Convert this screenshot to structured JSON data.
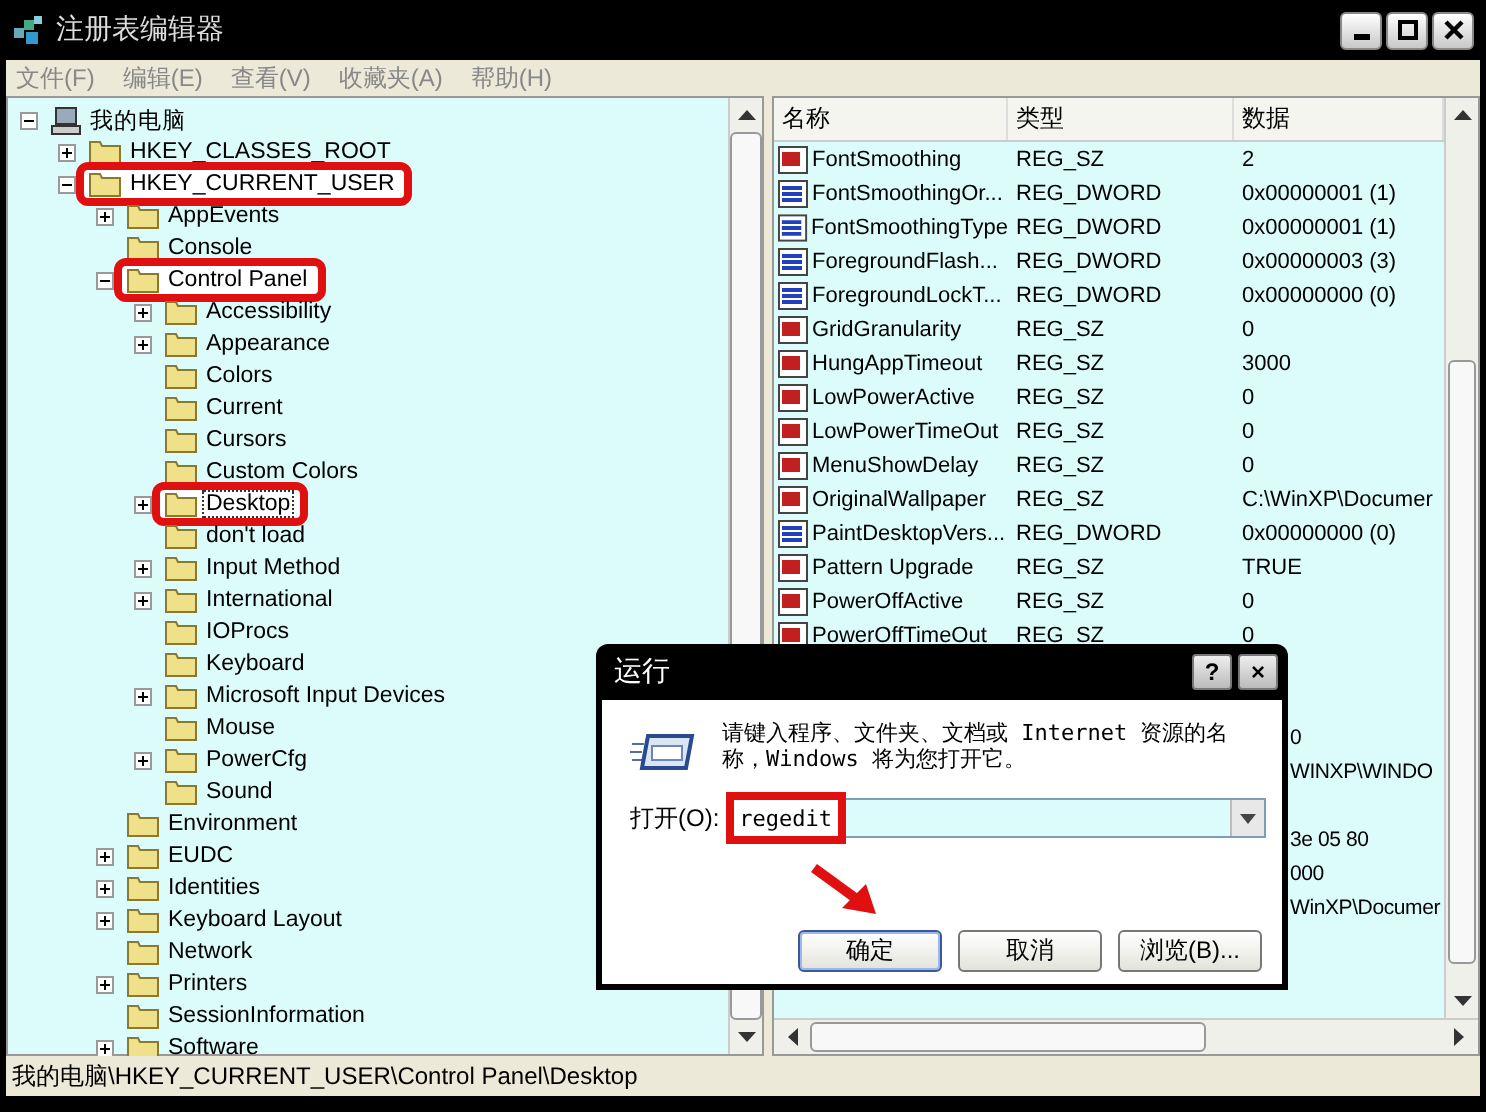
{
  "window": {
    "title": "注册表编辑器"
  },
  "menu": [
    "文件(F)",
    "编辑(E)",
    "查看(V)",
    "收藏夹(A)",
    "帮助(H)"
  ],
  "tree": {
    "label": "我的电脑",
    "kind": "open",
    "selected": false,
    "marked": false,
    "children": [
      {
        "label": "HKEY_CLASSES_ROOT",
        "kind": "closed",
        "selected": false,
        "marked": false
      },
      {
        "label": "HKEY_CURRENT_USER",
        "kind": "open",
        "selected": false,
        "marked": true,
        "children": [
          {
            "label": "AppEvents",
            "kind": "closed",
            "selected": false,
            "marked": false
          },
          {
            "label": "Console",
            "kind": "leaf",
            "selected": false,
            "marked": false
          },
          {
            "label": "Control Panel",
            "kind": "open",
            "selected": false,
            "marked": true,
            "children": [
              {
                "label": "Accessibility",
                "kind": "closed",
                "selected": false,
                "marked": false
              },
              {
                "label": "Appearance",
                "kind": "closed",
                "selected": false,
                "marked": false
              },
              {
                "label": "Colors",
                "kind": "leaf",
                "selected": false,
                "marked": false
              },
              {
                "label": "Current",
                "kind": "leaf",
                "selected": false,
                "marked": false
              },
              {
                "label": "Cursors",
                "kind": "leaf",
                "selected": false,
                "marked": false
              },
              {
                "label": "Custom Colors",
                "kind": "leaf",
                "selected": false,
                "marked": false
              },
              {
                "label": "Desktop",
                "kind": "closed",
                "selected": true,
                "marked": true
              },
              {
                "label": "don't load",
                "kind": "leaf",
                "selected": false,
                "marked": false
              },
              {
                "label": "Input Method",
                "kind": "closed",
                "selected": false,
                "marked": false
              },
              {
                "label": "International",
                "kind": "closed",
                "selected": false,
                "marked": false
              },
              {
                "label": "IOProcs",
                "kind": "leaf",
                "selected": false,
                "marked": false
              },
              {
                "label": "Keyboard",
                "kind": "leaf",
                "selected": false,
                "marked": false
              },
              {
                "label": "Microsoft Input Devices",
                "kind": "closed",
                "selected": false,
                "marked": false
              },
              {
                "label": "Mouse",
                "kind": "leaf",
                "selected": false,
                "marked": false
              },
              {
                "label": "PowerCfg",
                "kind": "closed",
                "selected": false,
                "marked": false
              },
              {
                "label": "Sound",
                "kind": "leaf",
                "selected": false,
                "marked": false
              }
            ]
          },
          {
            "label": "Environment",
            "kind": "leaf",
            "selected": false,
            "marked": false
          },
          {
            "label": "EUDC",
            "kind": "closed",
            "selected": false,
            "marked": false
          },
          {
            "label": "Identities",
            "kind": "closed",
            "selected": false,
            "marked": false
          },
          {
            "label": "Keyboard Layout",
            "kind": "closed",
            "selected": false,
            "marked": false
          },
          {
            "label": "Network",
            "kind": "leaf",
            "selected": false,
            "marked": false
          },
          {
            "label": "Printers",
            "kind": "closed",
            "selected": false,
            "marked": false
          },
          {
            "label": "SessionInformation",
            "kind": "leaf",
            "selected": false,
            "marked": false
          },
          {
            "label": "Software",
            "kind": "closed",
            "selected": false,
            "marked": false
          }
        ]
      }
    ]
  },
  "list": {
    "columns": [
      "名称",
      "类型",
      "数据"
    ],
    "rows": [
      {
        "kind": "sz",
        "name": "FontSmoothing",
        "type": "REG_SZ",
        "data": "2"
      },
      {
        "kind": "dword",
        "name": "FontSmoothingOr...",
        "type": "REG_DWORD",
        "data": "0x00000001 (1)"
      },
      {
        "kind": "dword",
        "name": "FontSmoothingType",
        "type": "REG_DWORD",
        "data": "0x00000001 (1)"
      },
      {
        "kind": "dword",
        "name": "ForegroundFlash...",
        "type": "REG_DWORD",
        "data": "0x00000003 (3)"
      },
      {
        "kind": "dword",
        "name": "ForegroundLockT...",
        "type": "REG_DWORD",
        "data": "0x00000000 (0)"
      },
      {
        "kind": "sz",
        "name": "GridGranularity",
        "type": "REG_SZ",
        "data": "0"
      },
      {
        "kind": "sz",
        "name": "HungAppTimeout",
        "type": "REG_SZ",
        "data": "3000"
      },
      {
        "kind": "sz",
        "name": "LowPowerActive",
        "type": "REG_SZ",
        "data": "0"
      },
      {
        "kind": "sz",
        "name": "LowPowerTimeOut",
        "type": "REG_SZ",
        "data": "0"
      },
      {
        "kind": "sz",
        "name": "MenuShowDelay",
        "type": "REG_SZ",
        "data": "0"
      },
      {
        "kind": "sz",
        "name": "OriginalWallpaper",
        "type": "REG_SZ",
        "data": "C:\\WinXP\\Documer"
      },
      {
        "kind": "dword",
        "name": "PaintDesktopVers...",
        "type": "REG_DWORD",
        "data": "0x00000000 (0)"
      },
      {
        "kind": "sz",
        "name": "Pattern Upgrade",
        "type": "REG_SZ",
        "data": "TRUE"
      },
      {
        "kind": "sz",
        "name": "PowerOffActive",
        "type": "REG_SZ",
        "data": "0"
      },
      {
        "kind": "sz",
        "name": "PowerOffTimeOut",
        "type": "REG_SZ",
        "data": "0"
      },
      {
        "kind": "covered"
      },
      {
        "kind": "covered"
      },
      {
        "kind": "covered",
        "data": "0"
      },
      {
        "kind": "covered",
        "data": "WINXP\\WINDO"
      },
      {
        "kind": "covered"
      },
      {
        "kind": "covered",
        "data": "3e 05 80"
      },
      {
        "kind": "covered",
        "data": "000"
      },
      {
        "kind": "covered",
        "data": "WinXP\\Documer"
      }
    ]
  },
  "status_bar": "我的电脑\\HKEY_CURRENT_USER\\Control Panel\\Desktop",
  "dialog": {
    "title": "运行",
    "help": "?",
    "close": "×",
    "message": "请键入程序、文件夹、文档或 Internet 资源的名称，Windows 将为您打开它。",
    "field_label": "打开(O):",
    "value": "regedit",
    "value_marked": true,
    "buttons": [
      {
        "label": "确定",
        "default": true
      },
      {
        "label": "取消",
        "default": false
      },
      {
        "label": "浏览(B)...",
        "default": false
      }
    ]
  }
}
